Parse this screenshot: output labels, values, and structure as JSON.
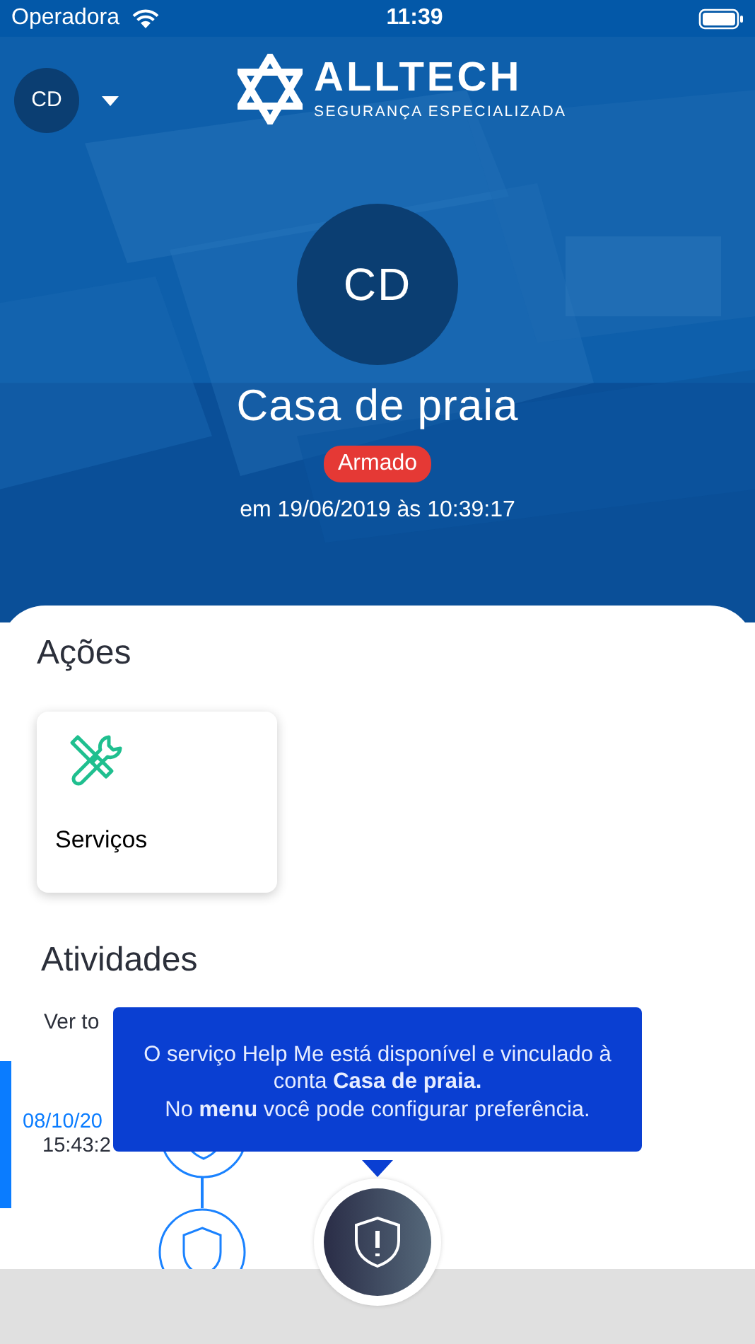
{
  "status_bar": {
    "carrier": "Operadora",
    "time": "11:39"
  },
  "header": {
    "account_initials": "CD",
    "logo_title": "ALLTECH",
    "logo_subtitle": "SEGURANÇA ESPECIALIZADA"
  },
  "site": {
    "initials": "CD",
    "name": "Casa de praia",
    "status": "Armado",
    "timestamp": "em 19/06/2019 às 10:39:17"
  },
  "actions": {
    "title": "Ações",
    "items": [
      {
        "label": "Serviços"
      }
    ]
  },
  "activities": {
    "title": "Atividades",
    "see_all": "Ver to",
    "items": [
      {
        "date": "08/10/20",
        "time": "15:43:2",
        "selected": true
      }
    ]
  },
  "tooltip": {
    "text": "O serviço Help Me está disponível e vinculado à conta **Casa de praia.**\nNo **menu** você pode configurar preferência."
  }
}
